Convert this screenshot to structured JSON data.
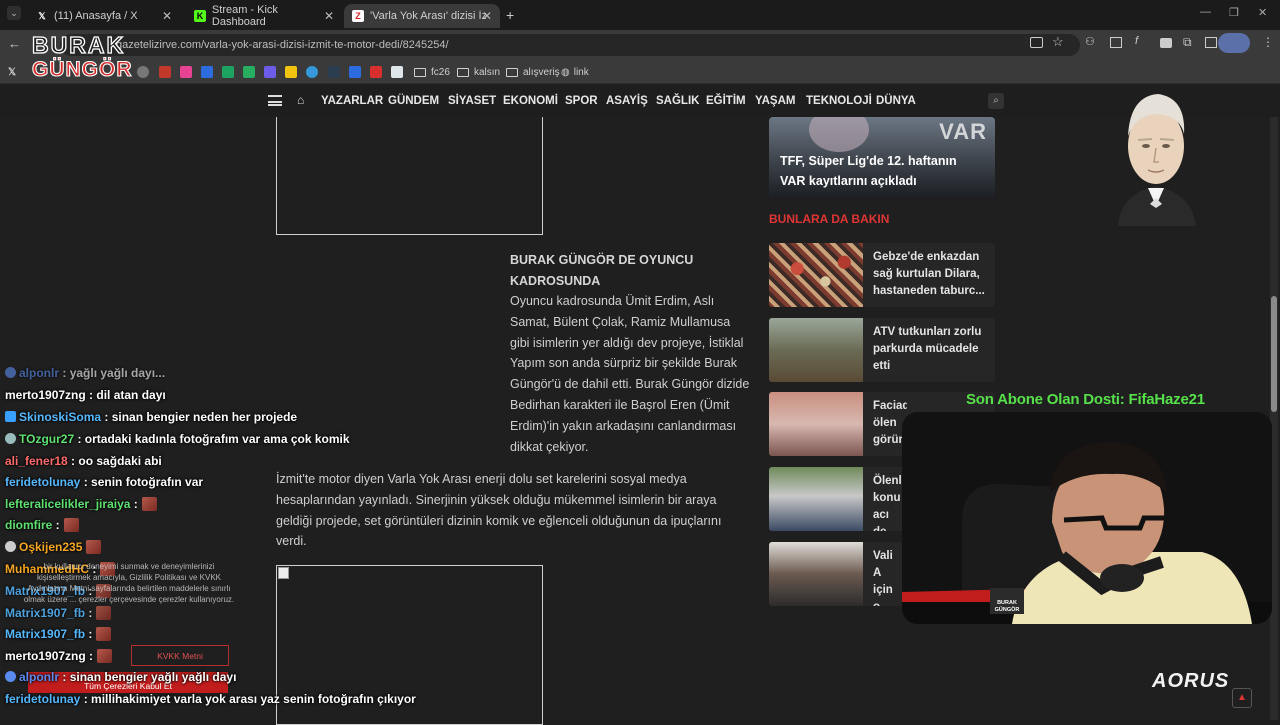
{
  "browser": {
    "tabs": [
      {
        "title": "(11) Anasayfa / X",
        "favicon": "X"
      },
      {
        "title": "Stream - Kick Dashboard",
        "favicon": "K"
      },
      {
        "title": "'Varla Yok Arası' dizisi İzmit'te",
        "favicon": "Z"
      }
    ],
    "url": "gazetelizirve.com/varla-yok-arasi-dizisi-izmit-te-motor-dedi/8245254/",
    "bookmarks": [
      "fc26",
      "kalsın",
      "alışveriş",
      "link"
    ]
  },
  "stream_logo": {
    "line1": "BURAK",
    "line2": "GÜNGÖR"
  },
  "site_nav": [
    "YAZARLAR",
    "GÜNDEM",
    "SİYASET",
    "EKONOMİ",
    "SPOR",
    "ASAYİŞ",
    "SAĞLIK",
    "EĞİTİM",
    "YAŞAM",
    "TEKNOLOJİ",
    "DÜNYA"
  ],
  "article": {
    "subheading": "BURAK GÜNGÖR DE OYUNCU KADROSUNDA",
    "para1": "Oyuncu kadrosunda Ümit Erdim, Aslı Samat, Bülent Çolak, Ramiz Mullamusa gibi isimlerin yer aldığı dev projeye, İstiklal Yapım son anda sürpriz bir şekilde Burak Güngör'ü de dahil etti. Burak Güngör dizide Bedirhan karakteri ile Başrol Eren (Ümit Erdim)'in yakın arkadaşını canlandırması dikkat çekiyor.",
    "para2": "İzmit'te motor diyen Varla Yok Arası enerji dolu set karelerini sosyal medya hesaplarından yayınladı. Sinerjinin yüksek olduğu mükemmel isimlerin bir araya geldiği projede, set görüntüleri dizinin komik ve eğlenceli olduğunun da ipuçlarını verdi."
  },
  "sidebar": {
    "top_story": "TFF, Süper Lig'de 12. haftanın VAR kayıtlarını açıkladı",
    "top_badge": "VAR",
    "section_title": "BUNLARA DA BAKIN",
    "related": [
      "Gebze'de enkazdan sağ kurtulan Dilara, hastaneden taburc...",
      "ATV tutkunları zorlu parkurda mücadele etti",
      "Faciada ölen görür",
      "Ölenl konu acı de",
      "Vali A için o katıld"
    ]
  },
  "overlay": {
    "subscriber": "Son Abone Olan Dosti: FifaHaze21",
    "brand": "AORUS",
    "cam_logo": "BURAK GÜNGÖR"
  },
  "chat": [
    {
      "user": "alponlr",
      "msg": "yağlı yağlı dayı...",
      "color": "#5a8cf0"
    },
    {
      "user": "merto1907zng",
      "msg": "dil atan dayı",
      "color": "#ffffff"
    },
    {
      "user": "SkinoskiSoma",
      "msg": "sinan bengier neden her projede",
      "color": "#56b8ff"
    },
    {
      "user": "TOzgur27",
      "msg": "ortadaki kadınla fotoğrafım var ama çok komik",
      "color": "#5ee070"
    },
    {
      "user": "ali_fener18",
      "msg": "oo sağdaki abi",
      "color": "#ff6b6b"
    },
    {
      "user": "feridetolunay",
      "msg": "senin fotoğrafın var",
      "color": "#56b8ff"
    },
    {
      "user": "lefteralicelikler_jiraiya",
      "msg": "",
      "color": "#5ee070"
    },
    {
      "user": "diomfire",
      "msg": "",
      "color": "#5ee070"
    },
    {
      "user": "Oşkijen235",
      "msg": "",
      "color": "#f5a623"
    },
    {
      "user": "MuhammedHC",
      "msg": "",
      "color": "#f5a623"
    },
    {
      "user": "Matrix1907_fb",
      "msg": "",
      "color": "#56b8ff"
    },
    {
      "user": "Matrix1907_fb",
      "msg": "",
      "color": "#56b8ff"
    },
    {
      "user": "Matrix1907_fb",
      "msg": "",
      "color": "#56b8ff"
    },
    {
      "user": "merto1907zng",
      "msg": "",
      "color": "#ffffff"
    },
    {
      "user": "alponlr",
      "msg": "sinan bengier yağlı yağlı dayı",
      "color": "#5a8cf0"
    },
    {
      "user": "feridetolunay",
      "msg": "millihakimiyet varla yok arası yaz senin fotoğrafın çıkıyor",
      "color": "#56b8ff"
    }
  ],
  "cookie": {
    "text": "bir kullanıcı deneyimi sunmak ve deneyimlerinizi kişiselleştirmek amacıyla, Gizlilik Politikası ve KVKK Aydınlatma Metni sayfalarında belirtilen maddelerle sınırlı olmak üzere ... çerezler çerçevesinde çerezler kullanıyoruz.",
    "kvkk_button": "KVKK Metni",
    "accept_button": "Tüm Çerezleri Kabul Et"
  }
}
